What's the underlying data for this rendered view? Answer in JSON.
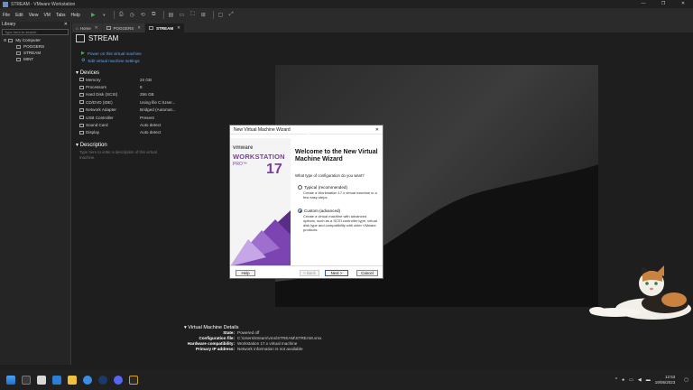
{
  "window": {
    "title": "STREAM - VMware Workstation",
    "controls": [
      "—",
      "❐",
      "✕"
    ]
  },
  "menu": [
    "File",
    "Edit",
    "View",
    "VM",
    "Tabs",
    "Help"
  ],
  "library": {
    "title": "Library",
    "close": "✕",
    "search_placeholder": "Type here to search",
    "tree": [
      {
        "label": "My Computer",
        "level": 0
      },
      {
        "label": "POGGERS",
        "level": 1
      },
      {
        "label": "STREAM",
        "level": 1
      },
      {
        "label": "MINT",
        "level": 1
      }
    ]
  },
  "tabs": [
    {
      "label": "Home",
      "close": "✕"
    },
    {
      "label": "POGGERS",
      "close": "✕"
    },
    {
      "label": "STREAM",
      "close": "✕"
    }
  ],
  "vm": {
    "name": "STREAM",
    "actions": [
      "Power on this virtual machine",
      "Edit virtual machine settings"
    ],
    "devices_title": "Devices",
    "devices": [
      {
        "name": "Memory",
        "value": "24 GB"
      },
      {
        "name": "Processors",
        "value": "8"
      },
      {
        "name": "Hard Disk (SCSI)",
        "value": "256 GB"
      },
      {
        "name": "CD/DVD (IDE)",
        "value": "Using file C:\\User..."
      },
      {
        "name": "Network Adapter",
        "value": "Bridged (Automat..."
      },
      {
        "name": "USB Controller",
        "value": "Present"
      },
      {
        "name": "Sound Card",
        "value": "Auto detect"
      },
      {
        "name": "Display",
        "value": "Auto detect"
      }
    ],
    "description_title": "Description",
    "description_placeholder": "Type here to enter a description of this virtual machine."
  },
  "details": {
    "title": "Virtual Machine Details",
    "rows": [
      {
        "key": "State:",
        "value": "Powered off"
      },
      {
        "key": "Configuration file:",
        "value": "C:\\Users\\stream\\vms\\STREAM\\STREAM.vmx"
      },
      {
        "key": "Hardware compatibility:",
        "value": "Workstation 17.x virtual machine"
      },
      {
        "key": "Primary IP address:",
        "value": "Network information is not available"
      }
    ]
  },
  "wizard": {
    "title": "New Virtual Machine Wizard",
    "close": "✕",
    "brand": "vmware",
    "product": "WORKSTATION",
    "edition": "PRO™",
    "version": "17",
    "heading": "Welcome to the New Virtual Machine Wizard",
    "question": "What type of configuration do you want?",
    "options": [
      {
        "label": "Typical (recommended)",
        "desc": "Create a Workstation 17.x virtual machine in a few easy steps.",
        "selected": false
      },
      {
        "label": "Custom (advanced)",
        "desc": "Create a virtual machine with advanced options, such as a SCSI controller type, virtual disk type and compatibility with older VMware products.",
        "selected": true
      }
    ],
    "buttons": {
      "help": "Help",
      "back": "< Back",
      "next": "Next >",
      "cancel": "Cancel"
    }
  },
  "clock": {
    "time": "12:53",
    "date": "19/06/2023"
  },
  "colors": {
    "accent": "#7a3ea0",
    "link": "#6aa3e0",
    "power": "#4caf50"
  }
}
